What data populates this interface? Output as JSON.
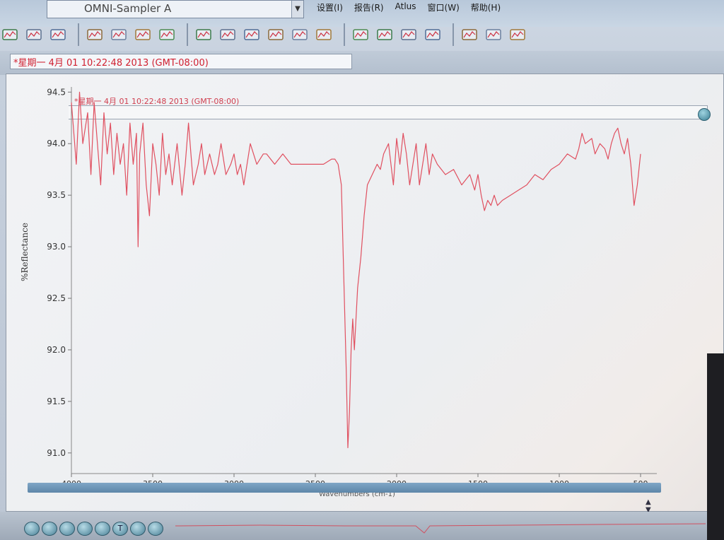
{
  "window": {
    "title": "OMNI-Sampler A",
    "combo_prefix": "..."
  },
  "menu": {
    "items": [
      "设置(I)",
      "报告(R)",
      "Atlus",
      "窗口(W)",
      "帮助(H)"
    ]
  },
  "toolbar": {
    "groups": [
      [
        "open-sample-icon",
        "collect-background-icon",
        "collect-sample-icon"
      ],
      [
        "open-file-icon",
        "save-icon",
        "print-icon",
        "mail-icon"
      ],
      [
        "baseline-icon",
        "correct-icon",
        "spectrum-arrange-icon",
        "spectrum-overlay-icon",
        "spectrum-stack-icon",
        "spectrum-peaks-icon"
      ],
      [
        "search-icon",
        "library-icon",
        "quant-icon",
        "analyze-icon"
      ],
      [
        "library-manager-icon",
        "copy-icon",
        "convert-icon"
      ]
    ]
  },
  "spectrum": {
    "date_field": "*星期一 4月 01 10:22:48 2013 (GMT-08:00)",
    "label": "*星期一 4月 01 10:22:48 2013 (GMT-08:00)"
  },
  "chart_data": {
    "type": "line",
    "title": "",
    "xlabel": "Wavenumbers (cm-1)",
    "ylabel": "%Reflectance",
    "xlim": [
      4000,
      400
    ],
    "ylim": [
      90.8,
      94.55
    ],
    "x_ticks": [
      4000,
      3500,
      3000,
      2500,
      2000,
      1500,
      1000,
      500
    ],
    "y_ticks": [
      94.5,
      94.0,
      93.5,
      93.0,
      92.5,
      92.0,
      91.5,
      91.0
    ],
    "grid": false,
    "line_color": "#e05060",
    "series": [
      {
        "name": "",
        "x": [
          4000,
          3990,
          3970,
          3950,
          3930,
          3900,
          3880,
          3860,
          3840,
          3820,
          3800,
          3780,
          3760,
          3740,
          3720,
          3700,
          3680,
          3660,
          3640,
          3620,
          3600,
          3590,
          3580,
          3560,
          3540,
          3520,
          3500,
          3480,
          3460,
          3440,
          3420,
          3400,
          3380,
          3350,
          3320,
          3300,
          3280,
          3250,
          3220,
          3200,
          3180,
          3150,
          3120,
          3100,
          3080,
          3050,
          3020,
          3000,
          2980,
          2960,
          2940,
          2900,
          2860,
          2820,
          2800,
          2750,
          2700,
          2650,
          2600,
          2550,
          2500,
          2450,
          2400,
          2380,
          2360,
          2350,
          2340,
          2330,
          2320,
          2310,
          2300,
          2290,
          2280,
          2270,
          2260,
          2240,
          2220,
          2200,
          2180,
          2150,
          2120,
          2100,
          2080,
          2050,
          2020,
          2000,
          1980,
          1960,
          1940,
          1920,
          1900,
          1880,
          1860,
          1840,
          1820,
          1800,
          1780,
          1750,
          1700,
          1650,
          1600,
          1550,
          1520,
          1500,
          1480,
          1460,
          1440,
          1420,
          1400,
          1380,
          1350,
          1300,
          1250,
          1200,
          1150,
          1100,
          1050,
          1000,
          950,
          900,
          880,
          860,
          840,
          800,
          780,
          750,
          720,
          700,
          680,
          660,
          640,
          620,
          600,
          580,
          560,
          540,
          520,
          500
        ],
        "y": [
          94.4,
          94.2,
          93.8,
          94.5,
          94.0,
          94.3,
          93.7,
          94.4,
          94.0,
          93.6,
          94.3,
          93.9,
          94.2,
          93.7,
          94.1,
          93.8,
          94.0,
          93.5,
          94.2,
          93.8,
          94.1,
          93.0,
          93.9,
          94.2,
          93.6,
          93.3,
          94.0,
          93.8,
          93.5,
          94.1,
          93.7,
          93.9,
          93.6,
          94.0,
          93.5,
          93.8,
          94.2,
          93.6,
          93.8,
          94.0,
          93.7,
          93.9,
          93.7,
          93.8,
          94.0,
          93.7,
          93.8,
          93.9,
          93.7,
          93.8,
          93.6,
          94.0,
          93.8,
          93.9,
          93.9,
          93.8,
          93.9,
          93.8,
          93.8,
          93.8,
          93.8,
          93.8,
          93.85,
          93.85,
          93.8,
          93.7,
          93.6,
          93.0,
          92.4,
          91.8,
          91.05,
          91.4,
          92.0,
          92.3,
          92.0,
          92.6,
          92.9,
          93.3,
          93.6,
          93.7,
          93.8,
          93.75,
          93.9,
          94.0,
          93.6,
          94.05,
          93.8,
          94.1,
          93.9,
          93.6,
          93.8,
          94.0,
          93.6,
          93.8,
          94.0,
          93.7,
          93.9,
          93.8,
          93.7,
          93.75,
          93.6,
          93.7,
          93.55,
          93.7,
          93.5,
          93.35,
          93.45,
          93.4,
          93.5,
          93.4,
          93.45,
          93.5,
          93.55,
          93.6,
          93.7,
          93.65,
          93.75,
          93.8,
          93.9,
          93.85,
          93.95,
          94.1,
          94.0,
          94.05,
          93.9,
          94.0,
          93.95,
          93.85,
          94.0,
          94.1,
          94.15,
          94.0,
          93.9,
          94.05,
          93.8,
          93.4,
          93.6,
          93.9
        ]
      }
    ]
  }
}
